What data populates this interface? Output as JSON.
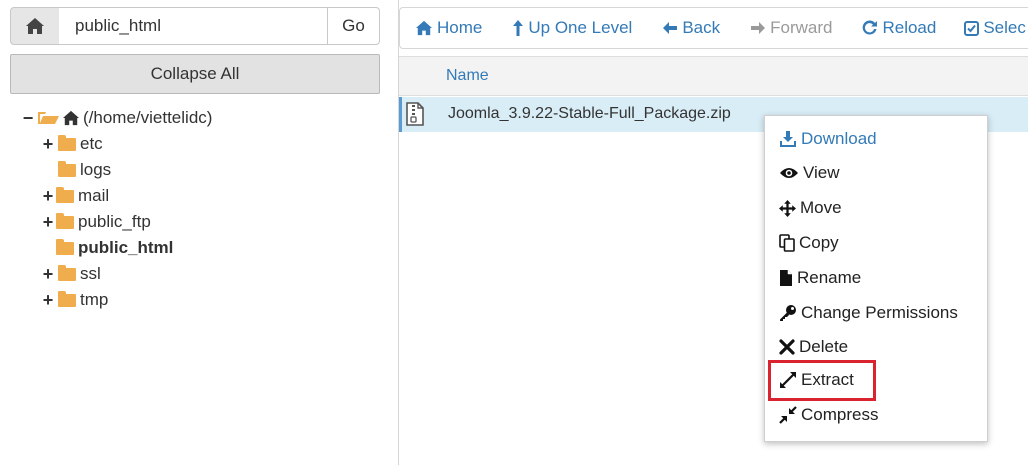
{
  "left_panel": {
    "path_value": "public_html",
    "go_label": "Go",
    "collapse_label": "Collapse All",
    "tree": {
      "root": {
        "toggle": "−",
        "label": "(/home/viettelidc)"
      },
      "items": [
        {
          "toggle": "+",
          "label": "etc"
        },
        {
          "toggle": "",
          "label": "logs"
        },
        {
          "toggle": "+",
          "label": "mail"
        },
        {
          "toggle": "+",
          "label": "public_ftp"
        },
        {
          "toggle": "",
          "label": "public_html",
          "selected": true
        },
        {
          "toggle": "+",
          "label": "ssl"
        },
        {
          "toggle": "+",
          "label": "tmp"
        }
      ]
    }
  },
  "toolbar": {
    "home": "Home",
    "up": "Up One Level",
    "back": "Back",
    "forward": "Forward",
    "reload": "Reload",
    "select": "Selec"
  },
  "file_list": {
    "header_name": "Name",
    "rows": [
      {
        "name": "Joomla_3.9.22-Stable-Full_Package.zip",
        "icon": "zip-file-icon"
      }
    ]
  },
  "context_menu": {
    "items": [
      {
        "label": "Download",
        "icon": "download-icon"
      },
      {
        "label": "View",
        "icon": "eye-icon"
      },
      {
        "label": "Move",
        "icon": "move-icon"
      },
      {
        "label": "Copy",
        "icon": "copy-icon"
      },
      {
        "label": "Rename",
        "icon": "file-icon"
      },
      {
        "label": "Change Permissions",
        "icon": "key-icon"
      },
      {
        "label": "Delete",
        "icon": "times-icon"
      },
      {
        "label": "Extract",
        "icon": "expand-icon"
      },
      {
        "label": "Compress",
        "icon": "compress-icon"
      }
    ]
  },
  "colors": {
    "accent": "#337ab7",
    "folder": "#f0ad4e",
    "highlight": "#d9232e",
    "selected_row": "#d9edf7"
  }
}
